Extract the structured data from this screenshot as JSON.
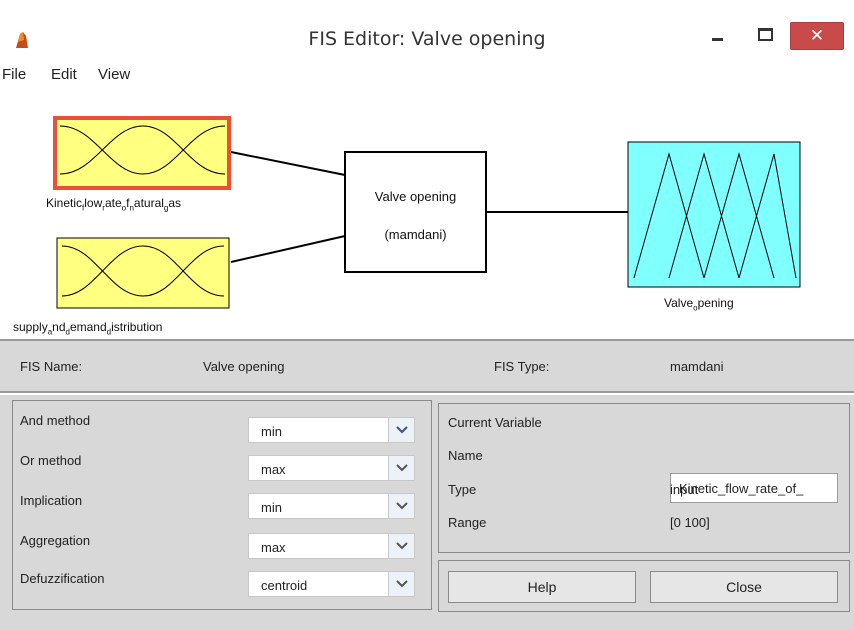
{
  "window": {
    "title": "FIS Editor: Valve opening",
    "close_glyph": "✕"
  },
  "menu": {
    "items": [
      "File",
      "Edit",
      "View"
    ]
  },
  "diagram": {
    "inputs": [
      {
        "parts": [
          "Kinetic",
          "f",
          "low",
          "r",
          "ate",
          "o",
          "f",
          "n",
          "atural",
          "g",
          "as"
        ],
        "selected": true
      },
      {
        "parts": [
          "supply",
          "a",
          "nd",
          "d",
          "emand",
          "d",
          "istribution"
        ],
        "selected": false
      }
    ],
    "engine": {
      "name": "Valve opening",
      "type": "(mamdani)"
    },
    "output": {
      "parts": [
        "Valve",
        "o",
        "pening"
      ]
    },
    "colors": {
      "input_fill": "#ffff80",
      "output_fill": "#80ffff",
      "selected_border": "#e8503a"
    }
  },
  "fis": {
    "name_label": "FIS Name:",
    "name_value": "Valve opening",
    "type_label": "FIS Type:",
    "type_value": "mamdani"
  },
  "methods": [
    {
      "label": "And method",
      "value": "min"
    },
    {
      "label": "Or method",
      "value": "max"
    },
    {
      "label": "Implication",
      "value": "min"
    },
    {
      "label": "Aggregation",
      "value": "max"
    },
    {
      "label": "Defuzzification",
      "value": "centroid"
    }
  ],
  "current_variable": {
    "heading": "Current Variable",
    "name_label": "Name",
    "name_value": "Kinetic_flow_rate_of_",
    "type_label": "Type",
    "type_value": "input",
    "range_label": "Range",
    "range_value": "[0 100]"
  },
  "buttons": {
    "help": "Help",
    "close": "Close"
  }
}
